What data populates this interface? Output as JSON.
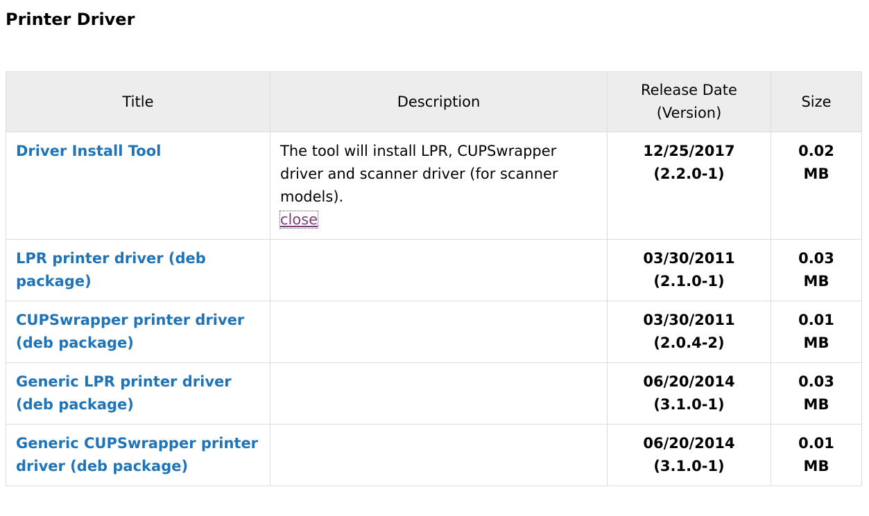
{
  "page": {
    "title": "Printer Driver"
  },
  "table": {
    "headers": {
      "title": "Title",
      "description": "Description",
      "release_date_line1": "Release Date",
      "release_date_line2": "(Version)",
      "size": "Size"
    },
    "rows": [
      {
        "title": "Driver Install Tool",
        "description": "The tool will install LPR, CUPSwrapper driver and scanner driver (for scanner models).",
        "close_label": "close",
        "date": "12/25/2017",
        "version": "(2.2.0-1)",
        "size_value": "0.02",
        "size_unit": "MB"
      },
      {
        "title": "LPR printer driver (deb package)",
        "date": "03/30/2011",
        "version": "(2.1.0-1)",
        "size_value": "0.03",
        "size_unit": "MB"
      },
      {
        "title": "CUPSwrapper printer driver (deb package)",
        "date": "03/30/2011",
        "version": "(2.0.4-2)",
        "size_value": "0.01",
        "size_unit": "MB"
      },
      {
        "title": "Generic LPR printer driver (deb package)",
        "date": "06/20/2014",
        "version": "(3.1.0-1)",
        "size_value": "0.03",
        "size_unit": "MB"
      },
      {
        "title": "Generic CUPSwrapper printer driver (deb package)",
        "date": "06/20/2014",
        "version": "(3.1.0-1)",
        "size_value": "0.01",
        "size_unit": "MB"
      }
    ]
  },
  "colors": {
    "link": "#1f74b8",
    "visited_link": "#7a3d79",
    "header_bg": "#ededed",
    "border": "#dcdcdc"
  }
}
